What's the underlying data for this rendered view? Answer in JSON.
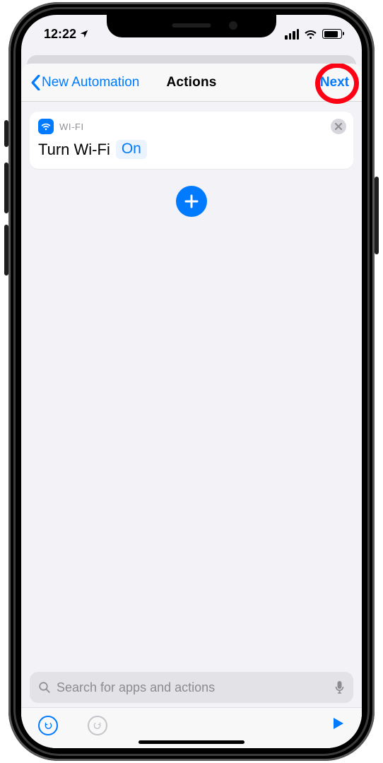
{
  "status": {
    "time": "12:22"
  },
  "nav": {
    "back_label": "New Automation",
    "title": "Actions",
    "next_label": "Next"
  },
  "action": {
    "category": "WI-FI",
    "text": "Turn Wi-Fi",
    "param_value": "On"
  },
  "search": {
    "placeholder": "Search for apps and actions"
  },
  "colors": {
    "accent": "#007aff",
    "annotation": "#ff0014"
  }
}
